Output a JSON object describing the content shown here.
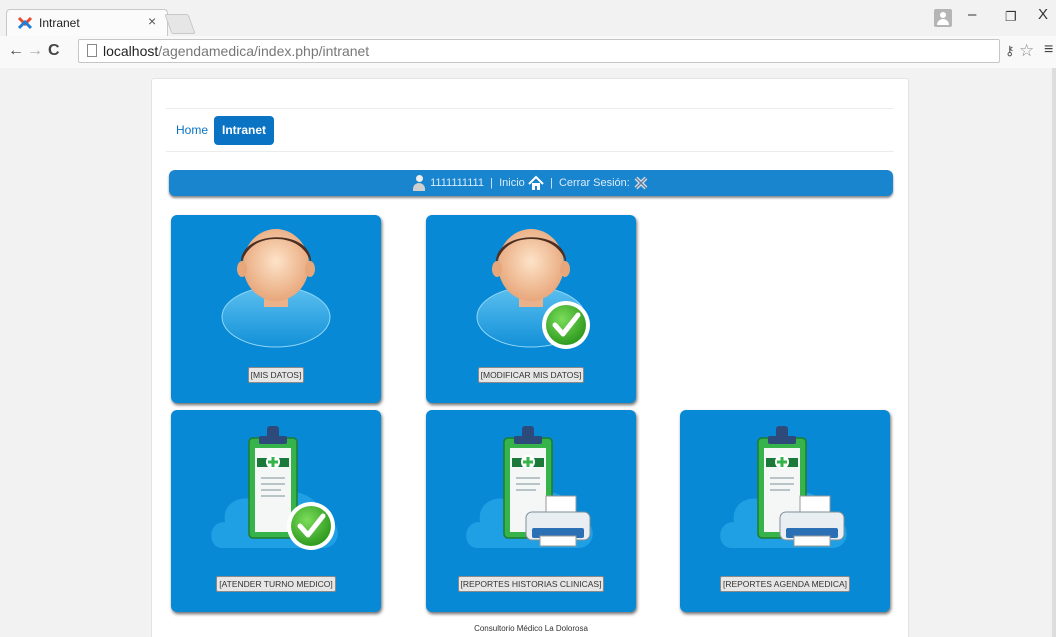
{
  "browser": {
    "tab_title": "Intranet",
    "tab_close": "×",
    "url_host": "localhost",
    "url_path": "/agendamedica/index.php/intranet",
    "window_minimize": "–",
    "window_maximize": "❐",
    "window_close": "X"
  },
  "nav": {
    "home": "Home",
    "intranet": "Intranet"
  },
  "userbar": {
    "user_id": "1111111111",
    "separator1": "|",
    "inicio": "Inicio",
    "separator2": "|",
    "cerrar_sesion": "Cerrar Sesión:"
  },
  "tiles": [
    {
      "label": "[MIS DATOS]",
      "icon": "user-avatar-icon"
    },
    {
      "label": "[MODIFICAR MIS DATOS]",
      "icon": "user-avatar-check-icon"
    },
    {
      "label": "[ATENDER TURNO MEDICO]",
      "icon": "clipboard-check-icon"
    },
    {
      "label": "[REPORTES HISTORIAS CLINICAS]",
      "icon": "clipboard-printer-icon"
    },
    {
      "label": "[REPORTES AGENDA MEDICA]",
      "icon": "clipboard-printer-icon"
    }
  ],
  "footer": "Consultorio Médico La Dolorosa",
  "colors": {
    "tile_blue": "#0789d5",
    "nav_active": "#0a73c4",
    "userbar_blue": "#1a85cf"
  }
}
